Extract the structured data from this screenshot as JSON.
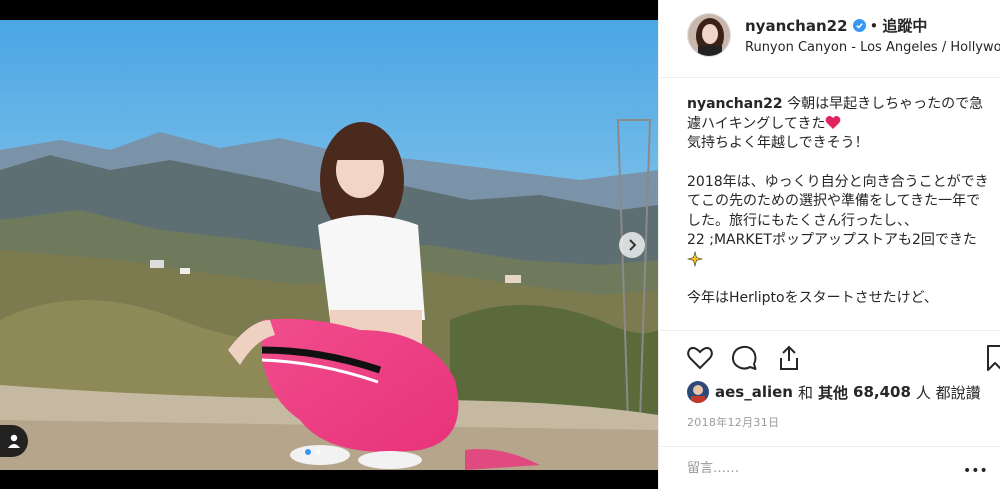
{
  "post": {
    "username": "nyanchan22",
    "verified": true,
    "separator": "•",
    "follow_status": "追蹤中",
    "location": "Runyon Canyon - Los Angeles / Hollywood"
  },
  "caption": {
    "username": "nyanchan22",
    "line1": "今朝は早起きしちゃったので急遽ハイキングしてきた",
    "line1_emoji": "heart-emoji",
    "line2": "気持ちよく年越しできそう！",
    "line3a": "2018年は、ゆっくり自分と向き合うことができてこの先のための選択や準備をしてきた一年でした。旅行にもたくさん行ったし、、",
    "line3b": "22 ;MARKETポップアップストアも2回できた",
    "line3b_emoji": "sparkle-emoji",
    "line4": "今年はHerliptoをスタートさせたけど、"
  },
  "likes": {
    "liker": "aes_alien",
    "connector": "和",
    "others_label": "其他",
    "count": "68,408",
    "suffix": "人 都說讚"
  },
  "date": "2018年12月31日",
  "comment": {
    "placeholder": "留言……",
    "more": "•••"
  },
  "icons": {
    "like": "heart-icon",
    "comment": "comment-icon",
    "share": "share-icon",
    "save": "bookmark-icon",
    "next": "chevron-right-icon",
    "tag": "user-tag-icon"
  },
  "colors": {
    "verified": "#3897f0",
    "accent": "#3897f0",
    "heart_emoji": "#e0245e",
    "muted": "#999999"
  }
}
